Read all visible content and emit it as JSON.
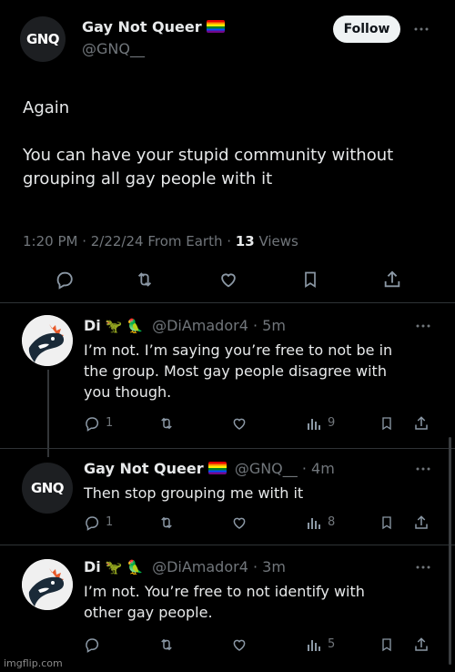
{
  "main_tweet": {
    "author_name": "Gay Not Queer",
    "author_handle": "@GNQ__",
    "avatar_text": "GNQ",
    "follow_label": "Follow",
    "text_line1": "Again",
    "text_line2": "You can have your stupid community without",
    "text_line3": "grouping all gay people with it",
    "timestamp": "1:20 PM · 2/22/24 From Earth · ",
    "views_count": "13",
    "views_label": " Views"
  },
  "replies": [
    {
      "author_name": "Di",
      "emoji": "🦖 🦜",
      "handle_time": "@DiAmador4 · 5m",
      "text_lines": [
        "I’m not. I’m saying you’re free to not be in",
        "the group. Most gay people disagree with",
        "you though."
      ],
      "reply_count": "1",
      "views_count": "9"
    },
    {
      "author_name": "Gay Not Queer",
      "handle_time": "@GNQ__ · 4m",
      "avatar_text": "GNQ",
      "text_lines": [
        "Then stop grouping me with it"
      ],
      "reply_count": "1",
      "views_count": "8"
    },
    {
      "author_name": "Di",
      "emoji": "🦖 🦜",
      "handle_time": "@DiAmador4 · 3m",
      "text_lines": [
        "I’m not. You’re free to not identify with",
        "other gay people."
      ],
      "reply_count": "",
      "views_count": "5"
    }
  ],
  "watermark": "imgflip.com",
  "colors": {
    "background": "#000000",
    "text": "#e7e9ea",
    "muted": "#71767b",
    "divider": "#2f3336"
  }
}
